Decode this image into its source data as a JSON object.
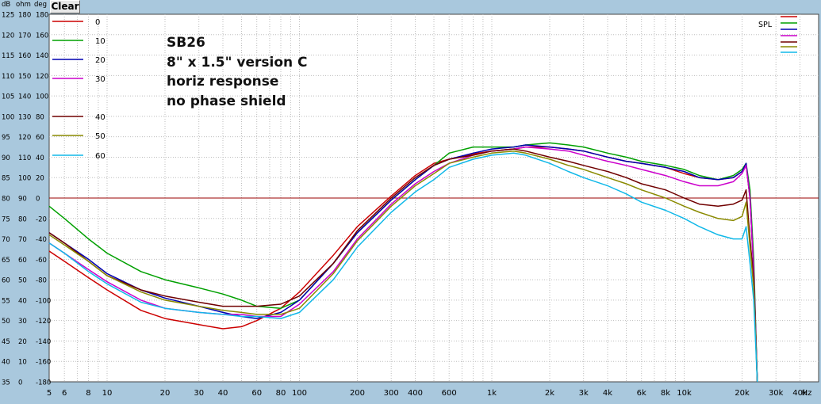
{
  "toolbar": {
    "clear_label": "Clear"
  },
  "annotation": {
    "lines": [
      "SB26",
      "8\" x 1.5\" version C",
      "horiz response",
      "no phase shield"
    ]
  },
  "chart_data": {
    "type": "line",
    "x_scale": "log",
    "x_unit": "Hz",
    "xlim": [
      5,
      50000
    ],
    "x_ticks": [
      {
        "v": 5,
        "label": "5"
      },
      {
        "v": 6,
        "label": "6"
      },
      {
        "v": 8,
        "label": "8"
      },
      {
        "v": 10,
        "label": "10"
      },
      {
        "v": 20,
        "label": "20"
      },
      {
        "v": 30,
        "label": "30"
      },
      {
        "v": 40,
        "label": "40"
      },
      {
        "v": 60,
        "label": "60"
      },
      {
        "v": 80,
        "label": "80"
      },
      {
        "v": 100,
        "label": "100"
      },
      {
        "v": 200,
        "label": "200"
      },
      {
        "v": 300,
        "label": "300"
      },
      {
        "v": 400,
        "label": "400"
      },
      {
        "v": 600,
        "label": "600"
      },
      {
        "v": 1000,
        "label": "1k"
      },
      {
        "v": 2000,
        "label": "2k"
      },
      {
        "v": 3000,
        "label": "3k"
      },
      {
        "v": 4000,
        "label": "4k"
      },
      {
        "v": 6000,
        "label": "6k"
      },
      {
        "v": 8000,
        "label": "8k"
      },
      {
        "v": 10000,
        "label": "10k"
      },
      {
        "v": 20000,
        "label": "20k"
      },
      {
        "v": 30000,
        "label": "30k"
      },
      {
        "v": 40000,
        "label": "40k"
      }
    ],
    "y_header": [
      "dB",
      "ohm",
      "deg"
    ],
    "ylim": [
      35,
      125
    ],
    "y_rows": [
      [
        "125",
        "180",
        "180"
      ],
      [
        "120",
        "170",
        "160"
      ],
      [
        "115",
        "160",
        "140"
      ],
      [
        "110",
        "150",
        "120"
      ],
      [
        "105",
        "140",
        "100"
      ],
      [
        "100",
        "130",
        "80"
      ],
      [
        "95",
        "120",
        "60"
      ],
      [
        "90",
        "110",
        "40"
      ],
      [
        "85",
        "100",
        "20"
      ],
      [
        "80",
        "90",
        "0"
      ],
      [
        "75",
        "80",
        "-20"
      ],
      [
        "70",
        "70",
        "-40"
      ],
      [
        "65",
        "60",
        "-60"
      ],
      [
        "60",
        "50",
        "-80"
      ],
      [
        "55",
        "40",
        "-100"
      ],
      [
        "50",
        "30",
        "-120"
      ],
      [
        "45",
        "20",
        "-140"
      ],
      [
        "40",
        "10",
        "-160"
      ],
      [
        "35",
        "0",
        "-180"
      ]
    ],
    "reference_line_db": 80,
    "spl_label": "SPL",
    "series": [
      {
        "name": "0",
        "color": "#cc0000",
        "data": [
          [
            5,
            67
          ],
          [
            6,
            64.5
          ],
          [
            8,
            60.5
          ],
          [
            10,
            57.5
          ],
          [
            15,
            52.5
          ],
          [
            20,
            50.5
          ],
          [
            30,
            49
          ],
          [
            40,
            48
          ],
          [
            50,
            48.5
          ],
          [
            60,
            50
          ],
          [
            80,
            53
          ],
          [
            100,
            57
          ],
          [
            150,
            66
          ],
          [
            200,
            73
          ],
          [
            300,
            80.5
          ],
          [
            400,
            85.5
          ],
          [
            500,
            88.5
          ],
          [
            600,
            89.5
          ],
          [
            800,
            90.8
          ],
          [
            1000,
            91.5
          ],
          [
            1300,
            92
          ],
          [
            1500,
            92.5
          ],
          [
            2000,
            92.5
          ],
          [
            2500,
            92
          ],
          [
            3000,
            91.5
          ],
          [
            4000,
            90
          ],
          [
            5000,
            89
          ],
          [
            6000,
            88.5
          ],
          [
            8000,
            87.5
          ],
          [
            10000,
            86
          ],
          [
            12000,
            85
          ],
          [
            15000,
            84.5
          ],
          [
            18000,
            85
          ],
          [
            20000,
            86.5
          ],
          [
            21000,
            88
          ],
          [
            22000,
            80
          ],
          [
            23000,
            62
          ],
          [
            24000,
            35
          ]
        ]
      },
      {
        "name": "10",
        "color": "#00a000",
        "data": [
          [
            5,
            78
          ],
          [
            6,
            75
          ],
          [
            8,
            70
          ],
          [
            10,
            66.5
          ],
          [
            15,
            62
          ],
          [
            20,
            60
          ],
          [
            30,
            58
          ],
          [
            40,
            56.5
          ],
          [
            50,
            55
          ],
          [
            60,
            53.5
          ],
          [
            80,
            53
          ],
          [
            100,
            55
          ],
          [
            150,
            64
          ],
          [
            200,
            71.5
          ],
          [
            300,
            79.5
          ],
          [
            400,
            84.5
          ],
          [
            500,
            88
          ],
          [
            600,
            91
          ],
          [
            800,
            92.5
          ],
          [
            1000,
            92.5
          ],
          [
            1300,
            92.5
          ],
          [
            1500,
            93
          ],
          [
            2000,
            93.5
          ],
          [
            2500,
            93
          ],
          [
            3000,
            92.5
          ],
          [
            4000,
            91
          ],
          [
            5000,
            90
          ],
          [
            6000,
            89
          ],
          [
            8000,
            88
          ],
          [
            10000,
            87
          ],
          [
            12000,
            85.5
          ],
          [
            15000,
            84.5
          ],
          [
            18000,
            85.5
          ],
          [
            20000,
            87
          ],
          [
            21000,
            88.5
          ],
          [
            22000,
            82
          ],
          [
            23000,
            65
          ],
          [
            24000,
            35
          ]
        ]
      },
      {
        "name": "20",
        "color": "#0000b0",
        "data": [
          [
            5,
            71.5
          ],
          [
            6,
            69
          ],
          [
            8,
            65
          ],
          [
            10,
            61.5
          ],
          [
            15,
            57.5
          ],
          [
            20,
            55.5
          ],
          [
            30,
            53.5
          ],
          [
            40,
            52
          ],
          [
            50,
            51
          ],
          [
            60,
            50.5
          ],
          [
            80,
            52
          ],
          [
            100,
            55
          ],
          [
            150,
            64
          ],
          [
            200,
            71.5
          ],
          [
            300,
            79.5
          ],
          [
            400,
            84.5
          ],
          [
            500,
            88
          ],
          [
            600,
            89.5
          ],
          [
            800,
            91
          ],
          [
            1000,
            92
          ],
          [
            1300,
            92.5
          ],
          [
            1500,
            93
          ],
          [
            2000,
            92.5
          ],
          [
            2500,
            92
          ],
          [
            3000,
            91.5
          ],
          [
            4000,
            90
          ],
          [
            5000,
            89
          ],
          [
            6000,
            88.5
          ],
          [
            8000,
            87.5
          ],
          [
            10000,
            86.5
          ],
          [
            12000,
            85
          ],
          [
            15000,
            84.5
          ],
          [
            18000,
            85
          ],
          [
            20000,
            86.5
          ],
          [
            21000,
            88.5
          ],
          [
            22000,
            80
          ],
          [
            23000,
            62
          ],
          [
            24000,
            35
          ]
        ]
      },
      {
        "name": "30",
        "color": "#cc00cc",
        "data": [
          [
            5,
            69
          ],
          [
            6,
            66.5
          ],
          [
            8,
            62.5
          ],
          [
            10,
            59.5
          ],
          [
            15,
            55
          ],
          [
            20,
            53
          ],
          [
            30,
            52
          ],
          [
            40,
            51.5
          ],
          [
            50,
            51.5
          ],
          [
            60,
            51
          ],
          [
            80,
            51
          ],
          [
            100,
            54
          ],
          [
            150,
            62
          ],
          [
            200,
            70
          ],
          [
            300,
            78.5
          ],
          [
            400,
            83.5
          ],
          [
            500,
            86.5
          ],
          [
            600,
            88.5
          ],
          [
            800,
            90.5
          ],
          [
            1000,
            91.5
          ],
          [
            1300,
            92
          ],
          [
            1500,
            92.5
          ],
          [
            2000,
            92
          ],
          [
            2500,
            91.5
          ],
          [
            3000,
            90.5
          ],
          [
            4000,
            89
          ],
          [
            5000,
            88
          ],
          [
            6000,
            87
          ],
          [
            8000,
            85.5
          ],
          [
            10000,
            84
          ],
          [
            12000,
            83
          ],
          [
            15000,
            83
          ],
          [
            18000,
            84
          ],
          [
            20000,
            86
          ],
          [
            21000,
            88
          ],
          [
            22000,
            80
          ],
          [
            23000,
            62
          ],
          [
            24000,
            35
          ]
        ]
      },
      {
        "name": "40",
        "color": "#700000",
        "data": [
          [
            5,
            71.5
          ],
          [
            6,
            69
          ],
          [
            8,
            64.5
          ],
          [
            10,
            61
          ],
          [
            15,
            57.5
          ],
          [
            20,
            56
          ],
          [
            30,
            54.5
          ],
          [
            40,
            53.5
          ],
          [
            50,
            53.5
          ],
          [
            60,
            53.5
          ],
          [
            80,
            54
          ],
          [
            100,
            56
          ],
          [
            150,
            64
          ],
          [
            200,
            72
          ],
          [
            300,
            80
          ],
          [
            400,
            85
          ],
          [
            500,
            88
          ],
          [
            600,
            89.5
          ],
          [
            800,
            90.5
          ],
          [
            1000,
            91.5
          ],
          [
            1300,
            92
          ],
          [
            1500,
            91.5
          ],
          [
            2000,
            90
          ],
          [
            2500,
            89
          ],
          [
            3000,
            88
          ],
          [
            4000,
            86.5
          ],
          [
            5000,
            85
          ],
          [
            6000,
            83.5
          ],
          [
            8000,
            82
          ],
          [
            10000,
            80
          ],
          [
            12000,
            78.5
          ],
          [
            15000,
            78
          ],
          [
            18000,
            78.5
          ],
          [
            20000,
            79.5
          ],
          [
            21000,
            82
          ],
          [
            22000,
            70
          ],
          [
            23000,
            60
          ],
          [
            24000,
            35
          ]
        ]
      },
      {
        "name": "50",
        "color": "#8a8a00",
        "data": [
          [
            5,
            71
          ],
          [
            6,
            68.5
          ],
          [
            8,
            64.5
          ],
          [
            10,
            61
          ],
          [
            15,
            57
          ],
          [
            20,
            55
          ],
          [
            30,
            53.5
          ],
          [
            40,
            52.5
          ],
          [
            50,
            52
          ],
          [
            60,
            51.5
          ],
          [
            80,
            51.5
          ],
          [
            100,
            53
          ],
          [
            150,
            61.5
          ],
          [
            200,
            69.5
          ],
          [
            300,
            78
          ],
          [
            400,
            83
          ],
          [
            500,
            86
          ],
          [
            600,
            88.5
          ],
          [
            800,
            90
          ],
          [
            1000,
            91
          ],
          [
            1300,
            91.5
          ],
          [
            1500,
            91
          ],
          [
            2000,
            89.5
          ],
          [
            2500,
            88
          ],
          [
            3000,
            87
          ],
          [
            4000,
            85
          ],
          [
            5000,
            83.5
          ],
          [
            6000,
            82
          ],
          [
            8000,
            80
          ],
          [
            10000,
            78
          ],
          [
            12000,
            76.5
          ],
          [
            15000,
            75
          ],
          [
            18000,
            74.5
          ],
          [
            20000,
            75.5
          ],
          [
            21000,
            79
          ],
          [
            22000,
            68
          ],
          [
            23000,
            58
          ],
          [
            24000,
            35
          ]
        ]
      },
      {
        "name": "60",
        "color": "#10b8e8",
        "data": [
          [
            5,
            69
          ],
          [
            6,
            66.5
          ],
          [
            8,
            62
          ],
          [
            10,
            59
          ],
          [
            15,
            54.5
          ],
          [
            20,
            53
          ],
          [
            30,
            52
          ],
          [
            40,
            51.5
          ],
          [
            50,
            51
          ],
          [
            60,
            51
          ],
          [
            80,
            50.5
          ],
          [
            100,
            52
          ],
          [
            150,
            60
          ],
          [
            200,
            68
          ],
          [
            300,
            76.5
          ],
          [
            400,
            81.5
          ],
          [
            500,
            84.5
          ],
          [
            600,
            87.5
          ],
          [
            800,
            89.5
          ],
          [
            1000,
            90.5
          ],
          [
            1300,
            91
          ],
          [
            1500,
            90.5
          ],
          [
            2000,
            88.5
          ],
          [
            2500,
            86.5
          ],
          [
            3000,
            85
          ],
          [
            4000,
            83
          ],
          [
            5000,
            81
          ],
          [
            6000,
            79
          ],
          [
            8000,
            77
          ],
          [
            10000,
            75
          ],
          [
            12000,
            73
          ],
          [
            15000,
            71
          ],
          [
            18000,
            70
          ],
          [
            20000,
            70
          ],
          [
            21000,
            73
          ],
          [
            22000,
            64
          ],
          [
            23000,
            55
          ],
          [
            24000,
            35
          ]
        ]
      }
    ]
  }
}
